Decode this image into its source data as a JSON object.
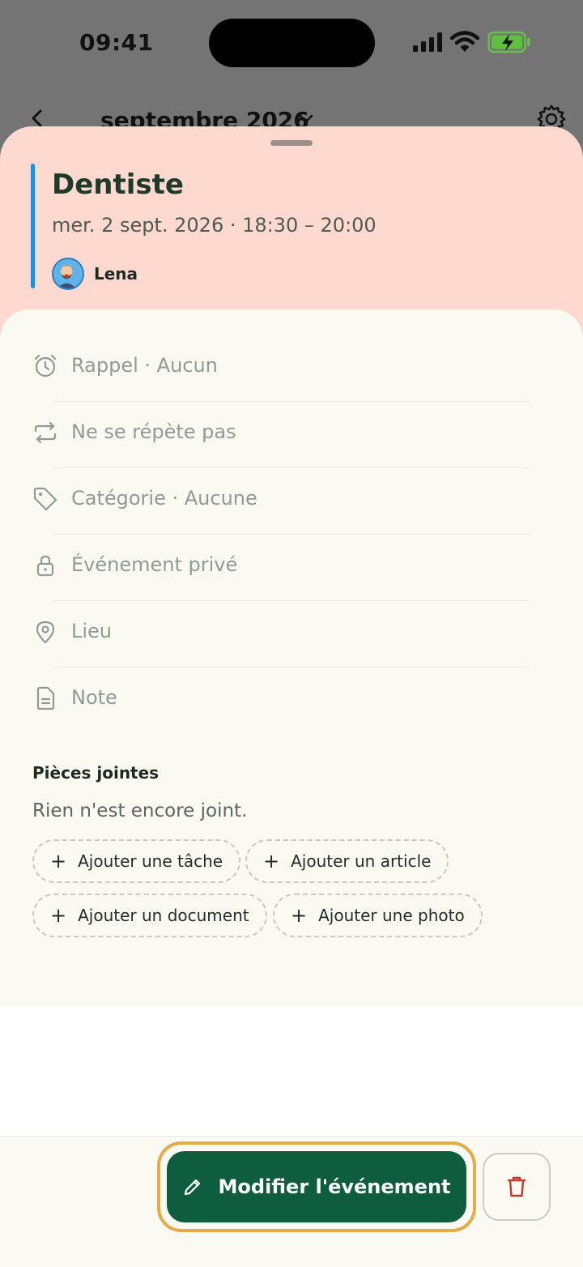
{
  "status_bar": {
    "time": "09:41"
  },
  "calendar_header": {
    "month_label": "septembre 2026"
  },
  "event": {
    "title": "Dentiste",
    "datetime": "mer. 2 sept. 2026 · 18:30 – 20:00",
    "owner": "Lena",
    "accent_color": "#1e8fe1"
  },
  "details": [
    {
      "icon": "alarm-clock-icon",
      "label": "Rappel · Aucun"
    },
    {
      "icon": "repeat-icon",
      "label": "Ne se répète pas"
    },
    {
      "icon": "tag-icon",
      "label": "Catégorie · Aucune"
    },
    {
      "icon": "lock-icon",
      "label": "Événement privé"
    },
    {
      "icon": "location-pin-icon",
      "label": "Lieu"
    },
    {
      "icon": "note-icon",
      "label": "Note"
    }
  ],
  "attachments": {
    "title": "Pièces jointes",
    "empty_text": "Rien n'est encore joint.",
    "actions": [
      {
        "label": "Ajouter une tâche"
      },
      {
        "label": "Ajouter un article"
      },
      {
        "label": "Ajouter un document"
      },
      {
        "label": "Ajouter une photo"
      }
    ]
  },
  "footer": {
    "edit_label": "Modifier l'événement",
    "primary_color": "#0e5d3e",
    "danger_color": "#c0392b"
  }
}
